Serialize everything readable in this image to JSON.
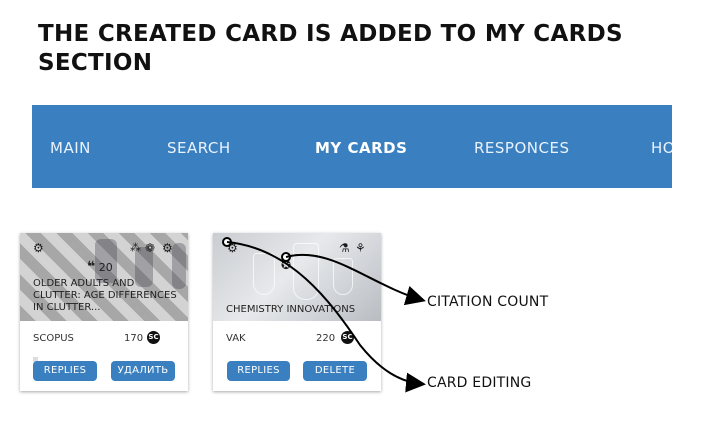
{
  "heading": "THE CREATED CARD IS ADDED TO MY CARDS SECTION",
  "nav": {
    "items": [
      {
        "label": "MAIN",
        "active": false
      },
      {
        "label": "SEARCH",
        "active": false
      },
      {
        "label": "MY CARDS",
        "active": true
      },
      {
        "label": "RESPONCES",
        "active": false
      },
      {
        "label": "HOME",
        "active": false
      }
    ],
    "background": "#3a80c1"
  },
  "cards": [
    {
      "title": "OLDER ADULTS AND CLUTTER: AGE DIFFERENCES IN CLUTTER...",
      "citations": "20",
      "source": "SCOPUS",
      "count": "170",
      "badge": "SC",
      "buttons": {
        "replies": "REPLIES",
        "second": "УДАЛИТЬ"
      },
      "icons": [
        "gear-icon",
        "network-icon",
        "brain-icon",
        "gear-icon",
        "quote-icon"
      ]
    },
    {
      "title": "CHEMISTRY INNOVATIONS",
      "source": "VAK",
      "count": "220",
      "badge": "SC",
      "buttons": {
        "replies": "REPLIES",
        "second": "DELETE"
      },
      "icons": [
        "gear-icon",
        "award-icon",
        "flask-icon",
        "lab-icon"
      ]
    }
  ],
  "annotations": {
    "citation_count": "CITATION COUNT",
    "card_editing": "CARD EDITING"
  },
  "colors": {
    "accent": "#3a80c1",
    "text": "#111111"
  }
}
